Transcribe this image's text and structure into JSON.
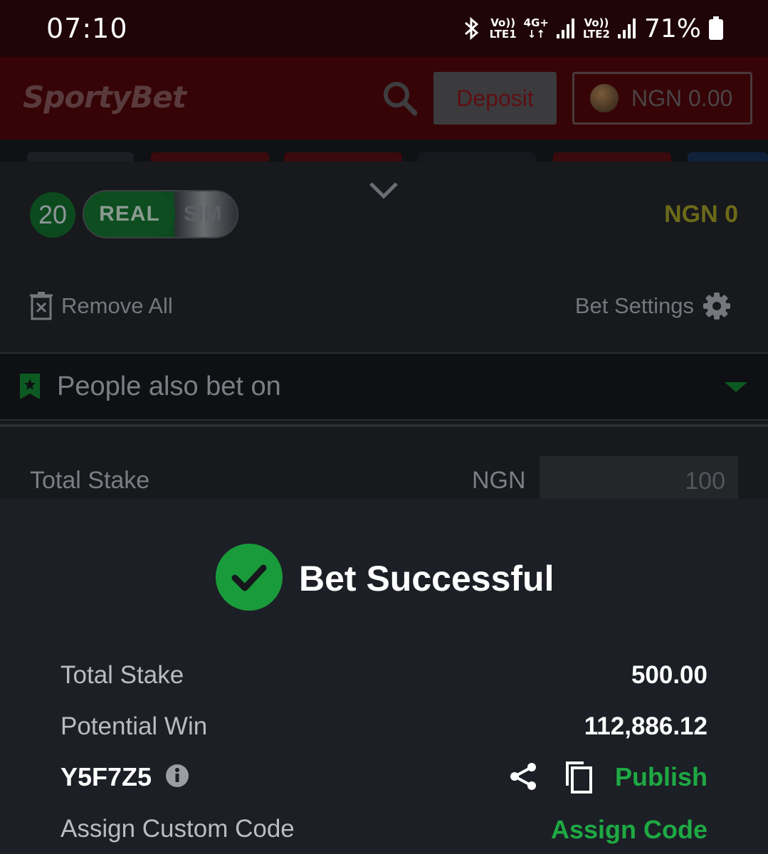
{
  "status_bar": {
    "time": "07:10",
    "sim1": "Vo))\nLTE1",
    "net_type": "4G+",
    "sim2": "Vo))\nLTE2",
    "battery": "71%"
  },
  "header": {
    "logo": "SportyBet",
    "deposit_label": "Deposit",
    "balance": "NGN 0.00"
  },
  "betslip": {
    "selection_count": "20",
    "mode_real": "REAL",
    "mode_sim": "SIM",
    "total_amount": "NGN 0",
    "remove_all": "Remove All",
    "bet_settings": "Bet Settings",
    "people_also_bet_on": "People also bet on",
    "total_stake_label": "Total Stake",
    "currency": "NGN",
    "stake_placeholder": "100"
  },
  "success": {
    "title": "Bet Successful",
    "total_stake_label": "Total Stake",
    "total_stake_value": "500.00",
    "potential_win_label": "Potential Win",
    "potential_win_value": "112,886.12",
    "booking_code": "Y5F7Z5",
    "publish_label": "Publish",
    "assign_custom_label": "Assign Custom Code",
    "assign_code_label": "Assign Code"
  },
  "colors": {
    "accent_green": "#1ea943",
    "header_red": "#360406",
    "panel_bg": "#1c1f25"
  }
}
